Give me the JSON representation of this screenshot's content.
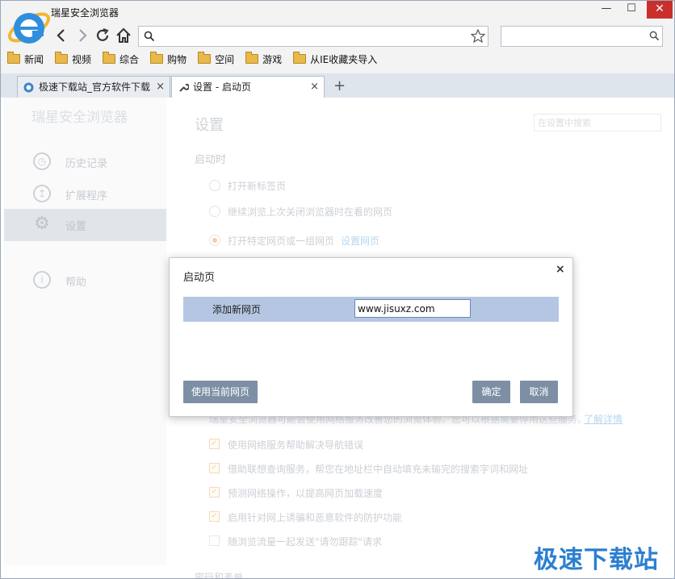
{
  "window": {
    "title": "瑞星安全浏览器",
    "controls": {
      "minimize": "—",
      "maximize": "☐",
      "close": "✕"
    }
  },
  "toolbar": {
    "back_icon": "back-arrow-icon",
    "forward_icon": "forward-arrow-icon",
    "refresh_icon": "refresh-icon",
    "home_icon": "home-icon",
    "address_value": "",
    "search_value": ""
  },
  "bookmarks": [
    {
      "label": "新闻"
    },
    {
      "label": "视频"
    },
    {
      "label": "综合"
    },
    {
      "label": "购物"
    },
    {
      "label": "空间"
    },
    {
      "label": "游戏"
    },
    {
      "label": "从IE收藏夹导入"
    }
  ],
  "tabs": [
    {
      "label": "极速下载站_官方软件下载",
      "close": "×"
    },
    {
      "label": "设置 - 启动页",
      "close": "×"
    }
  ],
  "new_tab": "+",
  "sidebar": {
    "brand": "瑞星安全浏览器",
    "items": [
      {
        "label": "历史记录",
        "icon": "clock-icon"
      },
      {
        "label": "扩展程序",
        "icon": "extension-icon"
      },
      {
        "label": "设置",
        "icon": "gear-icon"
      },
      {
        "label": "帮助",
        "icon": "info-icon"
      }
    ]
  },
  "settings": {
    "title": "设置",
    "search_placeholder": "在设置中搜索",
    "startup_heading": "启动时",
    "startup_options": [
      {
        "label": "打开新标签页",
        "selected": false
      },
      {
        "label": "继续浏览上次关闭浏览器时在看的网页",
        "selected": false
      },
      {
        "label": "打开特定网页或一组网页",
        "selected": true,
        "link": "设置网页"
      }
    ],
    "privacy_note": "瑞星安全浏览器可能会使用网络服务改善您的浏览体验。您可以根据需要停用这些服务。",
    "privacy_link": "了解详情",
    "privacy_options": [
      {
        "label": "使用网络服务帮助解决导航错误",
        "checked": true
      },
      {
        "label": "借助联想查询服务，帮您在地址栏中自动填充未输完的搜索字词和网址",
        "checked": true
      },
      {
        "label": "预测网络操作，以提高网页加载速度",
        "checked": true
      },
      {
        "label": "启用针对网上诱骗和恶意软件的防护功能",
        "checked": true
      },
      {
        "label": "随浏览流量一起发送\"请勿跟踪\"请求",
        "checked": false
      }
    ],
    "next_section": "密码和表单"
  },
  "dialog": {
    "title": "启动页",
    "close": "×",
    "row_label": "添加新网页",
    "url_value": "www.jisuxz.com",
    "use_current": "使用当前网页",
    "ok": "确定",
    "cancel": "取消"
  },
  "watermark": "极速下载站"
}
